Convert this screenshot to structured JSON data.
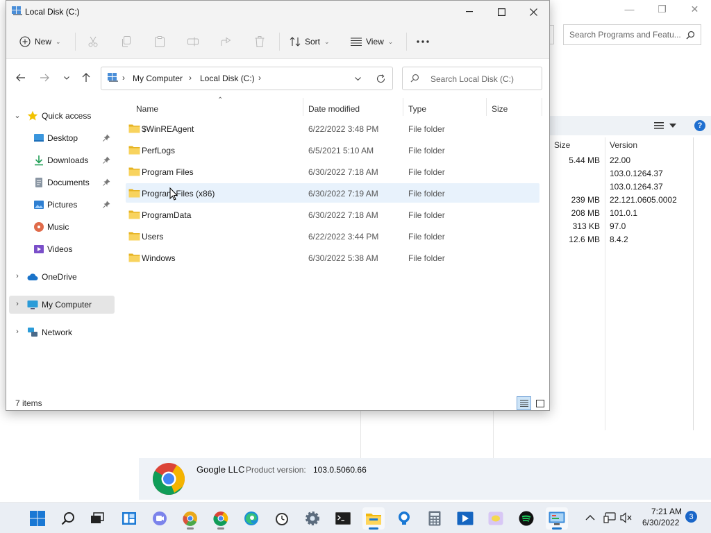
{
  "background_window": {
    "search_placeholder": "Search Programs and Featu...",
    "columns": {
      "size": "Size",
      "version": "Version"
    },
    "rows": [
      {
        "size": "5.44 MB",
        "version": "22.00"
      },
      {
        "size": "",
        "version": "103.0.1264.37"
      },
      {
        "size": "",
        "version": "103.0.1264.37"
      },
      {
        "size": "239 MB",
        "version": "22.121.0605.0002"
      },
      {
        "size": "208 MB",
        "version": "101.0.1"
      },
      {
        "size": "313 KB",
        "version": "97.0"
      },
      {
        "size": "12.6 MB",
        "version": "8.4.2"
      }
    ],
    "details": {
      "publisher": "Google LLC",
      "product_version_label": "Product version:",
      "product_version": "103.0.5060.66"
    }
  },
  "explorer": {
    "title": "Local Disk (C:)",
    "commands": {
      "new": "New",
      "sort": "Sort",
      "view": "View",
      "more": "..."
    },
    "breadcrumb": [
      "My Computer",
      "Local Disk (C:)"
    ],
    "search_placeholder": "Search Local Disk (C:)",
    "nav": {
      "quick_access": "Quick access",
      "desktop": "Desktop",
      "downloads": "Downloads",
      "documents": "Documents",
      "pictures": "Pictures",
      "music": "Music",
      "videos": "Videos",
      "onedrive": "OneDrive",
      "my_computer": "My Computer",
      "network": "Network"
    },
    "columns": {
      "name": "Name",
      "date": "Date modified",
      "type": "Type",
      "size": "Size"
    },
    "files": [
      {
        "name": "$WinREAgent",
        "date": "6/22/2022 3:48 PM",
        "type": "File folder"
      },
      {
        "name": "PerfLogs",
        "date": "6/5/2021 5:10 AM",
        "type": "File folder"
      },
      {
        "name": "Program Files",
        "date": "6/30/2022 7:18 AM",
        "type": "File folder"
      },
      {
        "name": "Program Files (x86)",
        "date": "6/30/2022 7:19 AM",
        "type": "File folder"
      },
      {
        "name": "ProgramData",
        "date": "6/30/2022 7:18 AM",
        "type": "File folder"
      },
      {
        "name": "Users",
        "date": "6/22/2022 3:44 PM",
        "type": "File folder"
      },
      {
        "name": "Windows",
        "date": "6/30/2022 5:38 AM",
        "type": "File folder"
      }
    ],
    "status": "7 items"
  },
  "taskbar": {
    "time": "7:21 AM",
    "date": "6/30/2022",
    "notifications": "3",
    "apps": [
      "start-icon",
      "search-icon",
      "task-view-icon",
      "widgets-icon",
      "teams-chat-icon",
      "chrome-canary-icon",
      "chrome-icon",
      "edge-icon",
      "alarms-icon",
      "settings-icon",
      "terminal-icon",
      "file-explorer-icon",
      "tips-icon",
      "calculator-icon",
      "media-player-icon",
      "sticky-icon",
      "spotify-icon",
      "control-panel-icon"
    ]
  },
  "colors": {
    "accent": "#1a73c9",
    "folder": "#f2c94c",
    "selection": "#e8f2fc"
  }
}
